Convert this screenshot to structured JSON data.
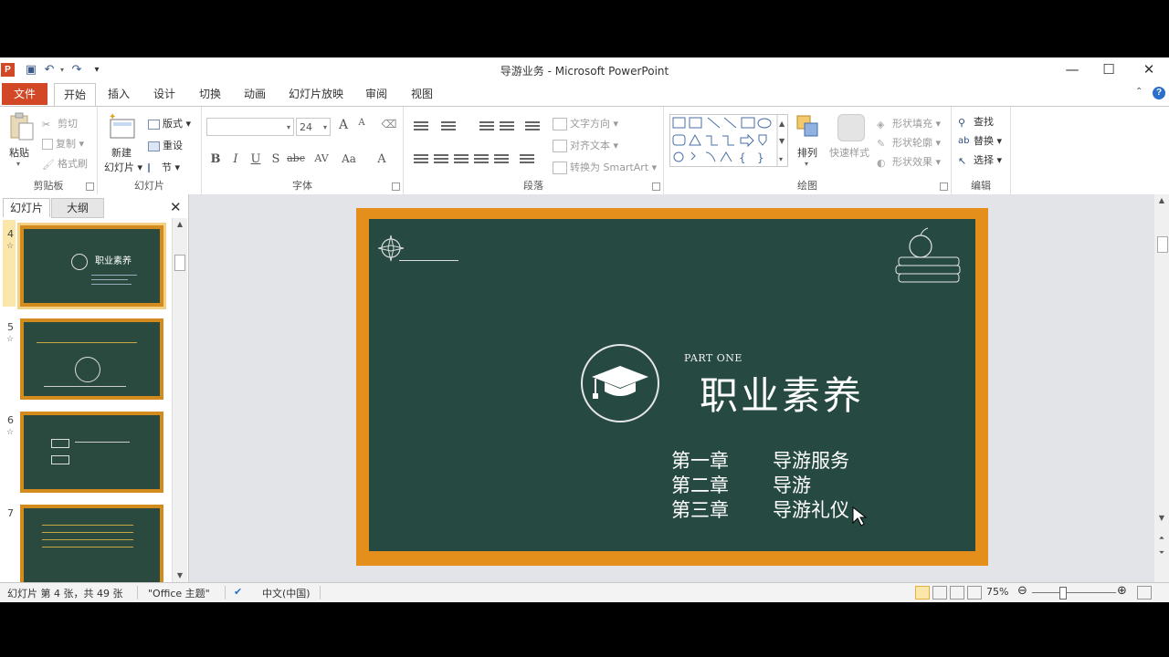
{
  "window": {
    "title": "导游业务 - Microsoft PowerPoint",
    "app_logo": "P"
  },
  "tabs": {
    "file": "文件",
    "items": [
      "开始",
      "插入",
      "设计",
      "切换",
      "动画",
      "幻灯片放映",
      "审阅",
      "视图"
    ],
    "active": "开始"
  },
  "ribbon": {
    "clipboard": {
      "label": "剪贴板",
      "paste": "粘贴",
      "cut": "剪切",
      "copy": "复制",
      "format_painter": "格式刷"
    },
    "slides": {
      "label": "幻灯片",
      "new_line1": "新建",
      "new_line2": "幻灯片",
      "layout": "版式",
      "reset": "重设",
      "section": "节"
    },
    "font": {
      "label": "字体",
      "font_name": "",
      "font_size": "24",
      "bold": "B",
      "italic": "I",
      "underline": "U",
      "strike": "S",
      "shadow": "abc",
      "spacing": "AV",
      "case": "Aa",
      "color": "A",
      "grow": "A",
      "shrink": "A"
    },
    "paragraph": {
      "label": "段落",
      "text_direction": "文字方向",
      "align_text": "对齐文本",
      "smartart": "转换为 SmartArt"
    },
    "drawing": {
      "label": "绘图",
      "arrange": "排列",
      "quick_styles": "快速样式",
      "fill": "形状填充",
      "outline": "形状轮廓",
      "effects": "形状效果"
    },
    "editing": {
      "label": "编辑",
      "find": "查找",
      "replace": "替换",
      "select": "选择"
    }
  },
  "pane": {
    "tab_slides": "幻灯片",
    "tab_outline": "大纲",
    "thumbnails": [
      {
        "num": "4",
        "title": "职业素养",
        "selected": true
      },
      {
        "num": "5",
        "title": "",
        "selected": false
      },
      {
        "num": "6",
        "title": "",
        "selected": false
      },
      {
        "num": "7",
        "title": "",
        "selected": false
      }
    ]
  },
  "slide": {
    "part": "PART ONE",
    "title": "职业素养",
    "chapters": [
      {
        "num": "第一章",
        "name": "导游服务"
      },
      {
        "num": "第二章",
        "name": "导游"
      },
      {
        "num": "第三章",
        "name": "导游礼仪"
      }
    ]
  },
  "status": {
    "slide_info": "幻灯片 第 4 张，共 49 张",
    "theme": "\"Office 主题\"",
    "language": "中文(中国)",
    "zoom": "75%"
  },
  "colors": {
    "accent": "#d24726",
    "board": "#264a42",
    "frame": "#e48f1c"
  }
}
